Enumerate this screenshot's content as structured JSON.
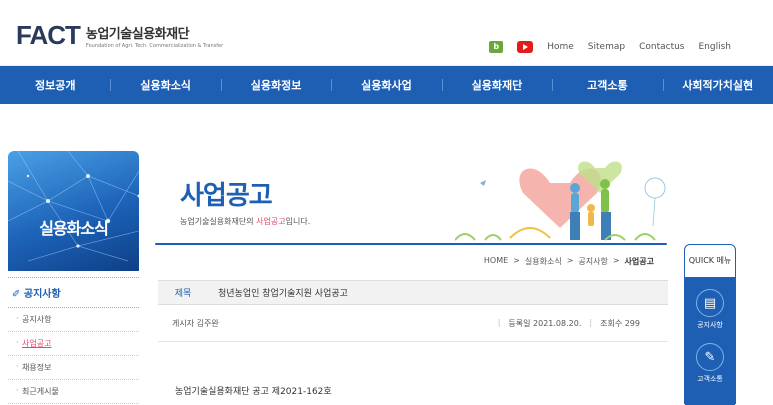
{
  "header": {
    "logo_mark": "FACT",
    "logo_ko": "농업기술실용화재단",
    "logo_en": "Foundation of Agri. Tech. Commercialization & Transfer",
    "util": [
      "Home",
      "Sitemap",
      "Contactus",
      "English"
    ],
    "blog_icon_letter": "b"
  },
  "gnb": [
    "정보공개",
    "실용화소식",
    "실용화정보",
    "실용화사업",
    "실용화재단",
    "고객소통",
    "사회적가치실현"
  ],
  "sidebar": {
    "title": "실용화소식",
    "head": "공지사항",
    "items": [
      {
        "label": "공지사항",
        "active": false
      },
      {
        "label": "사업공고",
        "active": true
      },
      {
        "label": "채용정보",
        "active": false
      },
      {
        "label": "최근게시물",
        "active": false
      }
    ]
  },
  "page": {
    "title": "사업공고",
    "desc_pre": "농업기술실용화재단의 ",
    "desc_hl": "사업공고",
    "desc_post": "입니다."
  },
  "breadcrumb": [
    "HOME",
    ">",
    "실용화소식",
    ">",
    "공지사항",
    ">",
    "사업공고"
  ],
  "post": {
    "subject_label": "제목",
    "subject": "청년농업인 창업기술지원 사업공고",
    "author": "게시자 김주완",
    "date": "등록일 2021.08.20.",
    "views": "조회수 299",
    "body": "농업기술실용화재단 공고 제2021-162호"
  },
  "quick": {
    "title": "QUICK 메뉴",
    "items": [
      "공지사항",
      "고객소통"
    ]
  }
}
